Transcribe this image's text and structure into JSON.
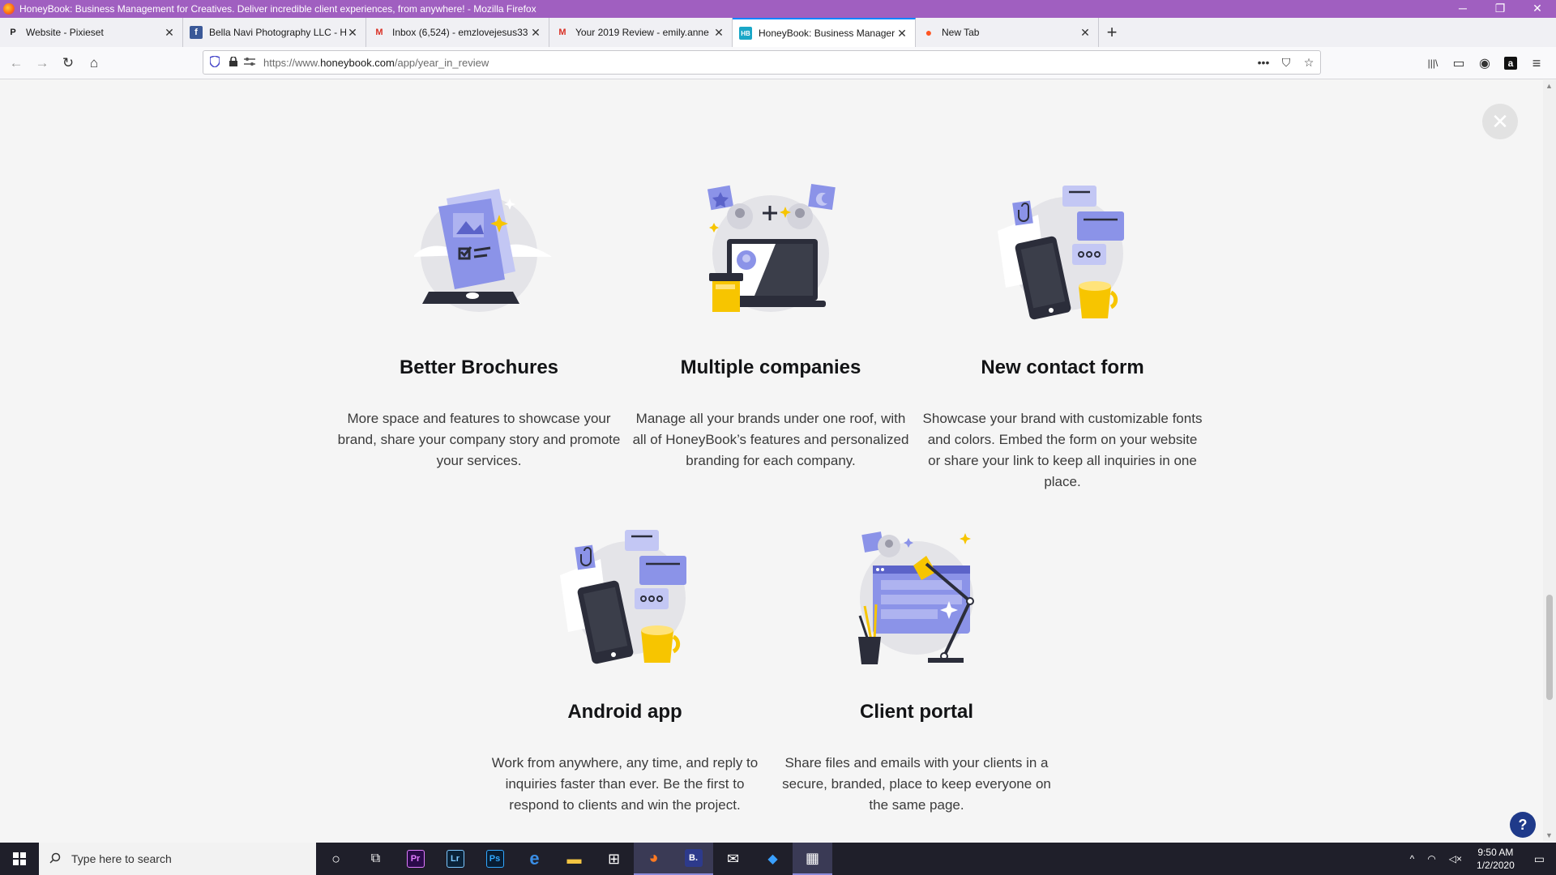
{
  "window": {
    "title": "HoneyBook: Business Management for Creatives. Deliver incredible client experiences, from anywhere! - Mozilla Firefox",
    "minimize": "─",
    "restore": "❐",
    "close": "✕"
  },
  "tabs": [
    {
      "label": "Website - Pixieset",
      "favicon": "P",
      "icon_color": "#222222"
    },
    {
      "label": "Bella Navi Photography LLC - H",
      "favicon": "f",
      "icon_color": "#3b5998"
    },
    {
      "label": "Inbox (6,524) - emzlovejesus33",
      "favicon": "M",
      "icon_color": "#d93025"
    },
    {
      "label": "Your 2019 Review - emily.anne",
      "favicon": "M",
      "icon_color": "#d93025"
    },
    {
      "label": "HoneyBook: Business Manager",
      "favicon": "HB",
      "icon_color": "#1aa7c7",
      "active": true
    },
    {
      "label": "New Tab",
      "favicon": "●",
      "icon_color": "#ff5522"
    }
  ],
  "tab_close": "✕",
  "new_tab": "+",
  "nav": {
    "back": "←",
    "forward": "→",
    "reload": "↻",
    "home": "⌂"
  },
  "url": {
    "prefix": "https://www.",
    "domain": "honeybook.com",
    "path": "/app/year_in_review"
  },
  "url_icons": {
    "more": "•••",
    "pocket": "⛉",
    "bookmark": "☆"
  },
  "toolbar_icons": {
    "library": "|||\\",
    "sidebar": "▭",
    "account": "◉",
    "amazon": "a",
    "menu": "≡"
  },
  "content": {
    "close": "✕",
    "features": [
      {
        "title": "Better Brochures",
        "description": "More space and features to showcase your brand, share your company story and promote your services."
      },
      {
        "title": "Multiple companies",
        "description": "Manage all your brands under one roof, with all of HoneyBook’s features and personalized branding for each company."
      },
      {
        "title": "New contact form",
        "description": "Showcase your brand with customizable fonts and colors. Embed the form on your website or share your link to keep all inquiries in one place."
      },
      {
        "title": "Android app",
        "description": "Work from anywhere, any time, and reply to inquiries faster than ever. Be the first to respond to clients and win the project."
      },
      {
        "title": "Client portal",
        "description": "Share files and emails with your clients in a secure, branded, place to keep everyone on the same page."
      }
    ],
    "help": "?"
  },
  "colors": {
    "accent_purple": "#8b93e8",
    "accent_yellow": "#f7c500",
    "dark": "#3b3e4a"
  },
  "taskbar": {
    "search_placeholder": "Type here to search",
    "apps": [
      {
        "name": "cortana",
        "glyph": "○"
      },
      {
        "name": "task-view",
        "glyph": "⧉"
      },
      {
        "name": "premiere",
        "glyph": "Pr",
        "color": "#2a0a4a",
        "fg": "#e07cff"
      },
      {
        "name": "lightroom",
        "glyph": "Lr",
        "color": "#0a2238",
        "fg": "#7cc8ff"
      },
      {
        "name": "photoshop",
        "glyph": "Ps",
        "color": "#081d33",
        "fg": "#31a8ff"
      },
      {
        "name": "edge",
        "glyph": "e",
        "color": "#1f1f2a",
        "fg": "#3a8ee6"
      },
      {
        "name": "file-explorer",
        "glyph": "▬",
        "color": "#1f1f2a",
        "fg": "#f4c542"
      },
      {
        "name": "store",
        "glyph": "⊞",
        "color": "#1f1f2a",
        "fg": "#ffffff"
      },
      {
        "name": "firefox",
        "glyph": "◕",
        "color": "#1f1f2a",
        "fg": "#ff7a22",
        "active": true
      },
      {
        "name": "b-app",
        "glyph": "B.",
        "color": "#2d3a8c",
        "fg": "#ffffff",
        "active": true
      },
      {
        "name": "mail",
        "glyph": "✉",
        "color": "#1f1f2a",
        "fg": "#ffffff"
      },
      {
        "name": "app-diamond",
        "glyph": "◆",
        "color": "#1f1f2a",
        "fg": "#3aa0ff"
      },
      {
        "name": "calculator",
        "glyph": "▦",
        "color": "#1f1f2a",
        "fg": "#ffffff",
        "active": true
      }
    ],
    "tray": {
      "chevron": "^",
      "network": "◠",
      "volume": "◁×",
      "time": "9:50 AM",
      "date": "1/2/2020",
      "notifications": "▭"
    }
  }
}
